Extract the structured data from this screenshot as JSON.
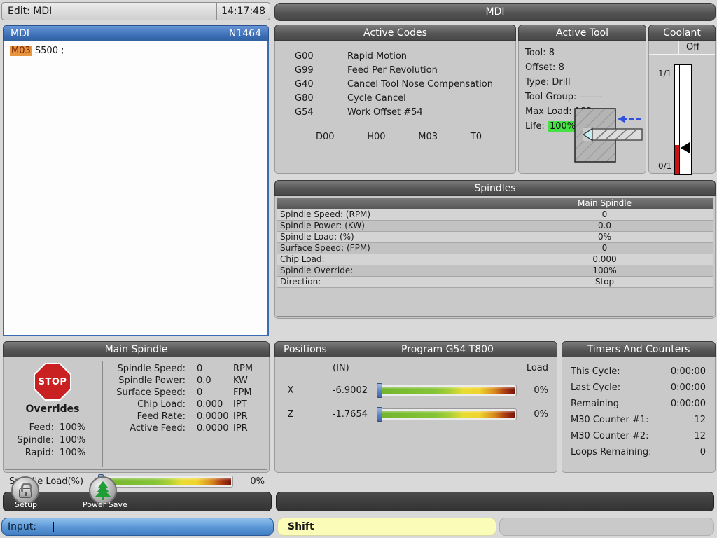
{
  "topbar": {
    "mode": "Edit: MDI",
    "time": "14:17:48",
    "screen_title": "MDI"
  },
  "mdi_window": {
    "title": "MDI",
    "line_number": "N1464",
    "code_highlight": "M03",
    "code_rest": " S500 ;"
  },
  "active_codes": {
    "title": "Active Codes",
    "rows": [
      {
        "code": "G00",
        "desc": "Rapid Motion"
      },
      {
        "code": "G99",
        "desc": "Feed Per Revolution"
      },
      {
        "code": "G40",
        "desc": "Cancel Tool Nose Compensation"
      },
      {
        "code": "G80",
        "desc": "Cycle Cancel"
      },
      {
        "code": "G54",
        "desc": "Work Offset #54"
      }
    ],
    "footer": [
      "D00",
      "H00",
      "M03",
      "T0"
    ]
  },
  "active_tool": {
    "title": "Active Tool",
    "tool": "Tool: 8",
    "offset": "Offset: 8",
    "type": "Type: Drill",
    "tool_group": "Tool Group: -------",
    "max_load": "Max Load: 182",
    "life_label": "Life:",
    "life_value": "100%"
  },
  "coolant": {
    "title": "Coolant",
    "status": "Off",
    "top_label": "1/1",
    "bottom_label": "0/1"
  },
  "spindles": {
    "title": "Spindles",
    "column_header": "Main Spindle",
    "rows": [
      {
        "label": "Spindle Speed: (RPM)",
        "value": "0"
      },
      {
        "label": "Spindle Power: (KW)",
        "value": "0.0"
      },
      {
        "label": "Spindle Load: (%)",
        "value": "0%"
      },
      {
        "label": "Surface Speed: (FPM)",
        "value": "0"
      },
      {
        "label": "Chip Load:",
        "value": "0.000"
      },
      {
        "label": "Spindle Override:",
        "value": "100%"
      },
      {
        "label": "Direction:",
        "value": "Stop"
      }
    ]
  },
  "main_spindle": {
    "title": "Main Spindle",
    "stop_label": "STOP",
    "overrides_title": "Overrides",
    "overrides": [
      {
        "label": "Feed:",
        "value": "100%"
      },
      {
        "label": "Spindle:",
        "value": "100%"
      },
      {
        "label": "Rapid:",
        "value": "100%"
      }
    ],
    "readouts": [
      {
        "label": "Spindle Speed:",
        "value": "0",
        "unit": "RPM"
      },
      {
        "label": "Spindle Power:",
        "value": "0.0",
        "unit": "KW"
      },
      {
        "label": "Surface Speed:",
        "value": "0",
        "unit": "FPM"
      },
      {
        "label": "Chip Load:",
        "value": "0.000",
        "unit": "IPT"
      },
      {
        "label": "Feed Rate:",
        "value": "0.0000",
        "unit": "IPR"
      },
      {
        "label": "Active Feed:",
        "value": "0.0000",
        "unit": "IPR"
      }
    ],
    "load_label": "Spindle Load(%)",
    "load_value": "0%"
  },
  "positions": {
    "title": "Positions",
    "program": "Program G54 T800",
    "unit_header": "(IN)",
    "load_header": "Load",
    "axes": [
      {
        "axis": "X",
        "value": "-6.9002",
        "load": "0%"
      },
      {
        "axis": "Z",
        "value": "-1.7654",
        "load": "0%"
      }
    ]
  },
  "timers": {
    "title": "Timers And Counters",
    "rows": [
      {
        "label": "This Cycle:",
        "value": "0:00:00"
      },
      {
        "label": "Last Cycle:",
        "value": "0:00:00"
      },
      {
        "label": "Remaining",
        "value": "0:00:00"
      },
      {
        "label": "M30 Counter #1:",
        "value": "12"
      },
      {
        "label": "M30 Counter #2:",
        "value": "12"
      },
      {
        "label": "Loops Remaining:",
        "value": "0"
      }
    ]
  },
  "toolbar": {
    "setup_label": "Setup",
    "power_save_label": "Power Save",
    "icons": {
      "setup": "lock-icon",
      "power_save": "pine-tree-icon"
    }
  },
  "input_bar": {
    "label": "Input:",
    "cursor": "|",
    "shift_label": "Shift"
  },
  "colors": {
    "accent_blue": "#4a7cc8",
    "header_gray": "#565656",
    "highlight_orange": "#e8953f",
    "life_green": "#44e044",
    "load_bar_green": "#85c437",
    "load_bar_red": "#77150b",
    "coolant_red": "#cc1212",
    "shift_yellow": "#fafcb8"
  }
}
